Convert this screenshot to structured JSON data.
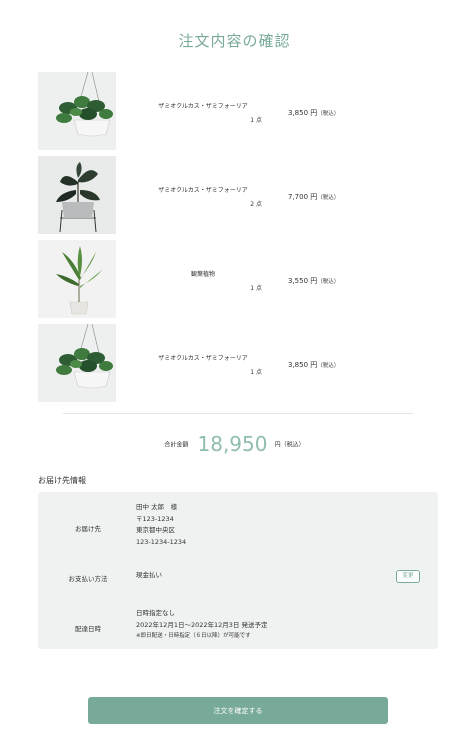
{
  "page": {
    "title": "注文内容の確認"
  },
  "items": [
    {
      "name": "ザミオクルカス・ザミフォーリア",
      "qty": "1 点",
      "price": "3,850 円",
      "tax": "（税込）",
      "image": "hanging-plant"
    },
    {
      "name": "ザミオクルカス・ザミフォーリア",
      "qty": "2 点",
      "price": "7,700 円",
      "tax": "（税込）",
      "image": "rubber-plant"
    },
    {
      "name": "観葉植物",
      "qty": "1 点",
      "price": "3,550 円",
      "tax": "（税込）",
      "image": "tall-plant"
    },
    {
      "name": "ザミオクルカス・ザミフォーリア",
      "qty": "1 点",
      "price": "3,850 円",
      "tax": "（税込）",
      "image": "hanging-plant"
    }
  ],
  "total": {
    "label": "合計金額",
    "amount": "18,950",
    "unit": "円（税込）"
  },
  "delivery": {
    "section_title": "お届け先情報",
    "address_label": "お届け先",
    "address_lines": [
      "田中 太郎　様",
      "〒123-1234",
      "東京都中央区",
      "123-1234-1234"
    ],
    "payment_label": "お支払い方法",
    "payment_value": "現金払い",
    "change_label": "変更",
    "datetime_label": "配達日時",
    "datetime_lines": [
      "日時指定なし",
      "2022年12月1日〜2022年12月3日 発送予定"
    ],
    "datetime_note": "※即日配送・日時指定（６日以降）が可能です"
  },
  "confirm_button": {
    "label": "注文を確定する"
  },
  "colors": {
    "accent": "#78aa9a",
    "total": "#8fbdb0",
    "panel": "#f0f2f1"
  }
}
